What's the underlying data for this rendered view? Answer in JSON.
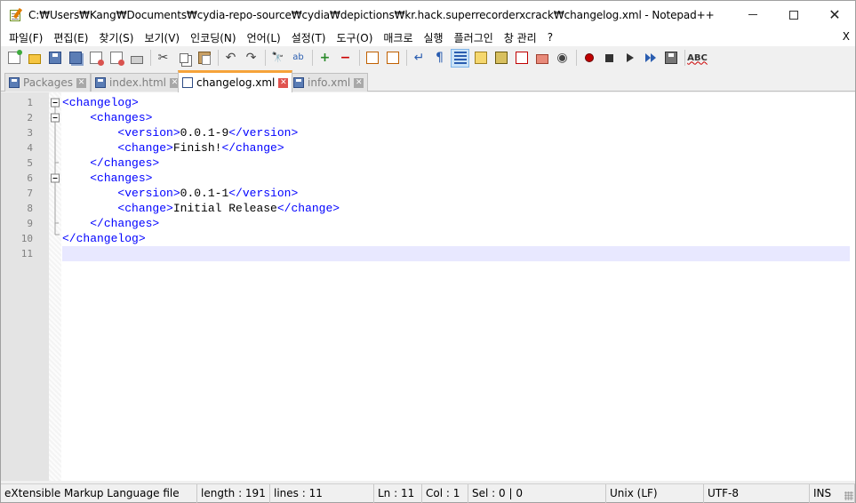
{
  "window": {
    "title": "C:₩Users₩Kang₩Documents₩cydia-repo-source₩cydia₩depictions₩kr.hack.superrecorderxcrack₩changelog.xml - Notepad++",
    "close_glyph": "✕",
    "app_icon": "notepad-plus-plus-icon"
  },
  "menu": {
    "items": [
      "파일(F)",
      "편집(E)",
      "찾기(S)",
      "보기(V)",
      "인코딩(N)",
      "언어(L)",
      "설정(T)",
      "도구(O)",
      "매크로",
      "실행",
      "플러그인",
      "창 관리",
      "?"
    ],
    "close_label": "X"
  },
  "toolbar": {
    "icons": [
      "new-file-icon",
      "open-file-icon",
      "save-icon",
      "save-all-icon",
      "close-icon",
      "close-all-icon",
      "print-icon",
      "cut-icon",
      "copy-icon",
      "paste-icon",
      "undo-icon",
      "redo-icon",
      "find-icon",
      "replace-icon",
      "zoom-in-icon",
      "zoom-out-icon",
      "sync-vertical-icon",
      "sync-horizontal-icon",
      "word-wrap-icon",
      "show-all-chars-icon",
      "indent-guide-icon",
      "user-language-icon",
      "doc-map-icon",
      "function-list-icon",
      "folder-as-workspace-icon",
      "monitoring-icon",
      "record-macro-icon",
      "stop-macro-icon",
      "play-macro-icon",
      "run-macro-multiple-icon",
      "save-macro-icon",
      "spell-check-icon"
    ],
    "glyphs": {
      "cut": "✂",
      "undo": "↶",
      "redo": "↷",
      "find": "🔭",
      "replace": "ab",
      "zoom_in": "+",
      "zoom_out": "−",
      "wrap": "↵",
      "pilcrow": "¶",
      "abc": "ABC",
      "eye": "◉"
    }
  },
  "tabs": [
    {
      "label": "Packages",
      "active": false
    },
    {
      "label": "index.html",
      "active": false
    },
    {
      "label": "changelog.xml",
      "active": true
    },
    {
      "label": "info.xml",
      "active": false
    }
  ],
  "tab_close_glyph": "✕",
  "editor": {
    "line_numbers": [
      "1",
      "2",
      "3",
      "4",
      "5",
      "6",
      "7",
      "8",
      "9",
      "10",
      "11"
    ],
    "current_line": 11,
    "lines": [
      {
        "indent": "",
        "open": "<changelog>",
        "text": "",
        "close": ""
      },
      {
        "indent": "    ",
        "open": "<changes>",
        "text": "",
        "close": ""
      },
      {
        "indent": "        ",
        "open": "<version>",
        "text": "0.0.1-9",
        "close": "</version>"
      },
      {
        "indent": "        ",
        "open": "<change>",
        "text": "Finish!",
        "close": "</change>"
      },
      {
        "indent": "    ",
        "open": "</changes>",
        "text": "",
        "close": ""
      },
      {
        "indent": "    ",
        "open": "<changes>",
        "text": "",
        "close": ""
      },
      {
        "indent": "        ",
        "open": "<version>",
        "text": "0.0.1-1",
        "close": "</version>"
      },
      {
        "indent": "        ",
        "open": "<change>",
        "text": "Initial Release",
        "close": "</change>"
      },
      {
        "indent": "    ",
        "open": "</changes>",
        "text": "",
        "close": ""
      },
      {
        "indent": "",
        "open": "</changelog>",
        "text": "",
        "close": ""
      },
      {
        "indent": "",
        "open": "",
        "text": "",
        "close": ""
      }
    ]
  },
  "status": {
    "language": "eXtensible Markup Language file",
    "length": "length : 191",
    "lines": "lines : 11",
    "ln": "Ln : 11",
    "col": "Col : 1",
    "sel": "Sel : 0 | 0",
    "eol": "Unix (LF)",
    "encoding": "UTF-8",
    "mode": "INS"
  },
  "colors": {
    "tag": "#0000ff",
    "text": "#000000",
    "active_tab_accent": "#f6a33a",
    "current_line": "#e8e8ff"
  }
}
